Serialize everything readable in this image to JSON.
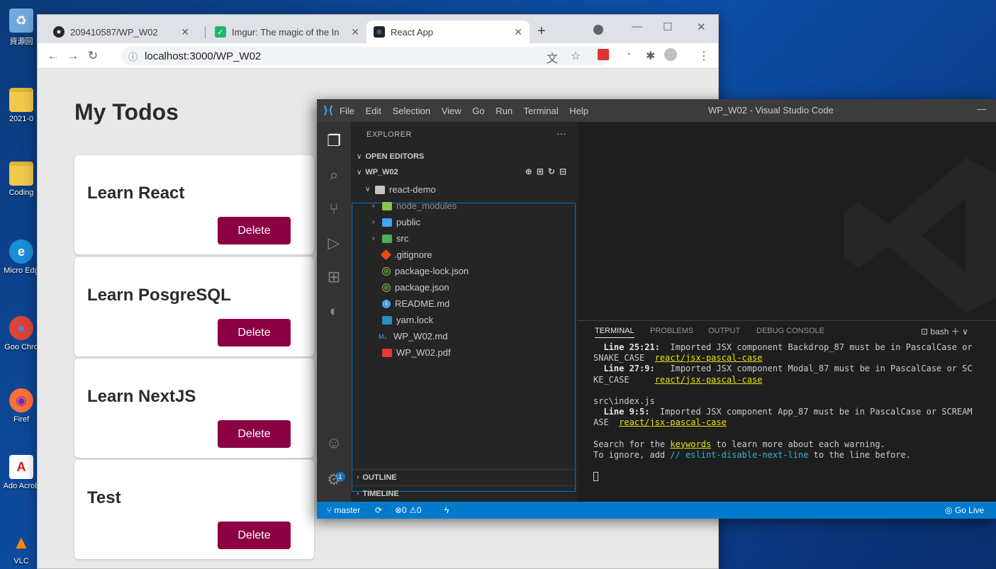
{
  "desktop": {
    "icons": [
      {
        "label": "資源回",
        "glyph": "♻"
      },
      {
        "label": "2021-0",
        "glyph": ""
      },
      {
        "label": "Coding",
        "glyph": ""
      },
      {
        "label": "Micro Edg",
        "glyph": "e"
      },
      {
        "label": "Goo Chro",
        "glyph": "●"
      },
      {
        "label": "Firef",
        "glyph": "◉"
      },
      {
        "label": "Ado Acrob",
        "glyph": "A"
      },
      {
        "label": "VLC",
        "glyph": "▲"
      }
    ]
  },
  "browser": {
    "tabs": [
      {
        "label": "209410587/WP_W02"
      },
      {
        "label": "Imgur: The magic of the In"
      },
      {
        "label": "React App"
      }
    ],
    "new_tab": "+",
    "url": "localhost:3000/WP_W02",
    "window_controls": {
      "minimize": "—",
      "maximize": "☐",
      "close": "✕"
    }
  },
  "page": {
    "title": "My Todos",
    "todos": [
      {
        "title": "Learn React",
        "action": "Delete"
      },
      {
        "title": "Learn PosgreSQL",
        "action": "Delete"
      },
      {
        "title": "Learn NextJS",
        "action": "Delete"
      },
      {
        "title": "Test",
        "action": "Delete"
      }
    ]
  },
  "vscode": {
    "menu": [
      "File",
      "Edit",
      "Selection",
      "View",
      "Go",
      "Run",
      "Terminal",
      "Help"
    ],
    "window_title": "WP_W02 - Visual Studio Code",
    "explorer": {
      "header": "EXPLORER",
      "more": "···",
      "open_editors": "OPEN EDITORS",
      "workspace": "WP_W02",
      "outline": "OUTLINE",
      "timeline": "TIMELINE",
      "tree": [
        {
          "name": "react-demo",
          "kind": "folder-open"
        },
        {
          "name": "node_modules",
          "kind": "folder"
        },
        {
          "name": "public",
          "kind": "folder"
        },
        {
          "name": "src",
          "kind": "folder"
        },
        {
          "name": ".gitignore",
          "kind": "git"
        },
        {
          "name": "package-lock.json",
          "kind": "json"
        },
        {
          "name": "package.json",
          "kind": "json"
        },
        {
          "name": "README.md",
          "kind": "info"
        },
        {
          "name": "yarn.lock",
          "kind": "yarn"
        },
        {
          "name": "WP_W02.md",
          "kind": "md"
        },
        {
          "name": "WP_W02.pdf",
          "kind": "pdf"
        }
      ]
    },
    "panel": {
      "tabs": [
        "TERMINAL",
        "PROBLEMS",
        "OUTPUT",
        "DEBUG CONSOLE"
      ],
      "shell": "bash",
      "terminal": {
        "l1_pos": "  Line 25:21:",
        "l1_msg": "  Imported JSX component Backdrop_87 must be in PascalCase or",
        "l2_pre": "SNAKE_CASE  ",
        "l2_rule": "react/jsx-pascal-case",
        "l3_pos": "  Line 27:9:",
        "l3_msg": "   Imported JSX component Modal_87 must be in PascalCase or SC",
        "l4_pre": "KE_CASE     ",
        "l4_rule": "react/jsx-pascal-case",
        "l5": "src\\index.js",
        "l6_pos": "  Line 9:5:",
        "l6_msg": "  Imported JSX component App_87 must be in PascalCase or SCREAM",
        "l7_pre": "ASE  ",
        "l7_rule": "react/jsx-pascal-case",
        "l8_a": "Search for the ",
        "l8_kw": "keywords",
        "l8_b": " to learn more about each warning.",
        "l9_a": "To ignore, add ",
        "l9_c": "// eslint-disable-next-line",
        "l9_b": " to the line before."
      }
    },
    "status": {
      "branch": "master",
      "sync": "⟳",
      "errors": "⊗0",
      "warnings": "⚠0",
      "go_live": "Go Live"
    }
  }
}
